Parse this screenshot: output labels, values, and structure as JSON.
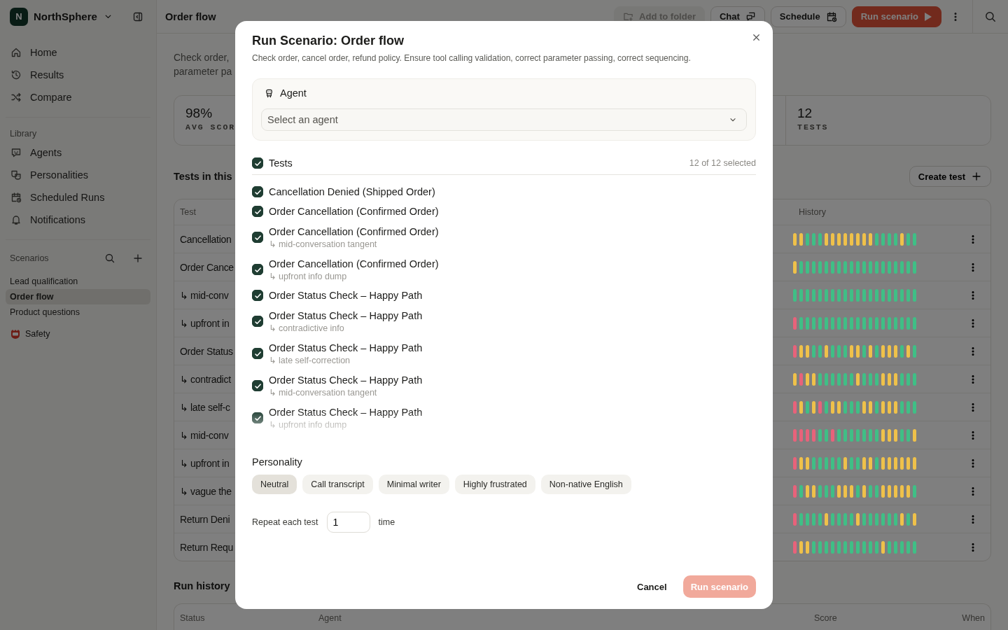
{
  "sidebar": {
    "workspace": {
      "initial": "N",
      "name": "NorthSphere"
    },
    "nav": [
      {
        "label": "Home",
        "kind": "home"
      },
      {
        "label": "Results",
        "kind": "history"
      },
      {
        "label": "Compare",
        "kind": "shuffle"
      }
    ],
    "library_label": "Library",
    "library": [
      {
        "label": "Agents",
        "kind": "agent"
      },
      {
        "label": "Personalities",
        "kind": "masks"
      },
      {
        "label": "Scheduled Runs",
        "kind": "calendar"
      },
      {
        "label": "Notifications",
        "kind": "bell"
      }
    ],
    "scenarios_label": "Scenarios",
    "scenarios": [
      {
        "label": "Lead qualification",
        "selected": false
      },
      {
        "label": "Order flow",
        "selected": true
      },
      {
        "label": "Product questions",
        "selected": false
      }
    ],
    "folders": [
      {
        "label": "Safety"
      }
    ]
  },
  "topbar": {
    "title": "Order flow",
    "actions": [
      {
        "label": "Add to folder",
        "kind": "folder",
        "disabled": true
      },
      {
        "label": "Chat",
        "kind": "chat",
        "disabled": false
      },
      {
        "label": "Schedule",
        "kind": "calendar",
        "disabled": false
      },
      {
        "label": "Run scenario",
        "kind": "run",
        "disabled": false
      }
    ]
  },
  "page": {
    "description": [
      "Check order,",
      "parameter pa"
    ],
    "stats": [
      {
        "value": "98%",
        "label": "AVG SCOR"
      },
      {
        "value": "12",
        "label": "TESTS"
      }
    ],
    "tests_heading": "Tests in this",
    "create_button": "Create test",
    "table": {
      "columns": [
        "Test",
        "History"
      ],
      "rows": [
        {
          "test": "Cancellation",
          "history": [
            {
              "color": "#efc14a"
            },
            {
              "color": "#efc14a"
            },
            {
              "color": "#3fbf86"
            },
            {
              "color": "#3fbf86"
            },
            {
              "color": "#3fbf86"
            },
            {
              "color": "#efc14a"
            },
            {
              "color": "#efc14a"
            },
            {
              "color": "#efc14a"
            },
            {
              "color": "#efc14a"
            },
            {
              "color": "#efc14a"
            },
            {
              "color": "#efc14a"
            },
            {
              "color": "#efc14a"
            },
            {
              "color": "#efc14a"
            },
            {
              "color": "#3fbf86"
            },
            {
              "color": "#3fbf86"
            },
            {
              "color": "#3fbf86"
            },
            {
              "color": "#3fbf86"
            },
            {
              "color": "#efc14a"
            },
            {
              "color": "#3fbf86"
            },
            {
              "color": "#3fbf86"
            }
          ]
        },
        {
          "test": "Order Cance",
          "history": [
            {
              "color": "#efc14a"
            },
            {
              "color": "#3fbf86"
            },
            {
              "color": "#3fbf86"
            },
            {
              "color": "#3fbf86"
            },
            {
              "color": "#3fbf86"
            },
            {
              "color": "#3fbf86"
            },
            {
              "color": "#3fbf86"
            },
            {
              "color": "#3fbf86"
            },
            {
              "color": "#3fbf86"
            },
            {
              "color": "#3fbf86"
            },
            {
              "color": "#3fbf86"
            },
            {
              "color": "#3fbf86"
            },
            {
              "color": "#3fbf86"
            },
            {
              "color": "#3fbf86"
            },
            {
              "color": "#3fbf86"
            },
            {
              "color": "#3fbf86"
            },
            {
              "color": "#3fbf86"
            },
            {
              "color": "#3fbf86"
            },
            {
              "color": "#3fbf86"
            },
            {
              "color": "#3fbf86"
            }
          ]
        },
        {
          "test": "↳ mid-conv",
          "history": [
            {
              "color": "#3fbf86"
            },
            {
              "color": "#3fbf86"
            },
            {
              "color": "#3fbf86"
            },
            {
              "color": "#3fbf86"
            },
            {
              "color": "#3fbf86"
            },
            {
              "color": "#3fbf86"
            },
            {
              "color": "#3fbf86"
            },
            {
              "color": "#3fbf86"
            },
            {
              "color": "#3fbf86"
            },
            {
              "color": "#3fbf86"
            },
            {
              "color": "#3fbf86"
            },
            {
              "color": "#3fbf86"
            },
            {
              "color": "#3fbf86"
            },
            {
              "color": "#3fbf86"
            },
            {
              "color": "#3fbf86"
            },
            {
              "color": "#3fbf86"
            },
            {
              "color": "#3fbf86"
            },
            {
              "color": "#3fbf86"
            },
            {
              "color": "#3fbf86"
            },
            {
              "color": "#3fbf86"
            }
          ]
        },
        {
          "test": "↳ upfront in",
          "history": [
            {
              "color": "#e8627a"
            },
            {
              "color": "#3fbf86"
            },
            {
              "color": "#3fbf86"
            },
            {
              "color": "#3fbf86"
            },
            {
              "color": "#3fbf86"
            },
            {
              "color": "#3fbf86"
            },
            {
              "color": "#3fbf86"
            },
            {
              "color": "#3fbf86"
            },
            {
              "color": "#3fbf86"
            },
            {
              "color": "#3fbf86"
            },
            {
              "color": "#3fbf86"
            },
            {
              "color": "#3fbf86"
            },
            {
              "color": "#3fbf86"
            },
            {
              "color": "#3fbf86"
            },
            {
              "color": "#3fbf86"
            },
            {
              "color": "#3fbf86"
            },
            {
              "color": "#3fbf86"
            },
            {
              "color": "#3fbf86"
            },
            {
              "color": "#3fbf86"
            },
            {
              "color": "#3fbf86"
            }
          ]
        },
        {
          "test": "Order Status",
          "history": [
            {
              "color": "#e8627a"
            },
            {
              "color": "#efc14a"
            },
            {
              "color": "#efc14a"
            },
            {
              "color": "#3fbf86"
            },
            {
              "color": "#3fbf86"
            },
            {
              "color": "#efc14a"
            },
            {
              "color": "#3fbf86"
            },
            {
              "color": "#3fbf86"
            },
            {
              "color": "#3fbf86"
            },
            {
              "color": "#efc14a"
            },
            {
              "color": "#efc14a"
            },
            {
              "color": "#3fbf86"
            },
            {
              "color": "#efc14a"
            },
            {
              "color": "#3fbf86"
            },
            {
              "color": "#efc14a"
            },
            {
              "color": "#efc14a"
            },
            {
              "color": "#efc14a"
            },
            {
              "color": "#3fbf86"
            },
            {
              "color": "#efc14a"
            },
            {
              "color": "#3fbf86"
            }
          ]
        },
        {
          "test": "↳ contradict",
          "history": [
            {
              "color": "#efc14a"
            },
            {
              "color": "#e8627a"
            },
            {
              "color": "#efc14a"
            },
            {
              "color": "#efc14a"
            },
            {
              "color": "#3fbf86"
            },
            {
              "color": "#3fbf86"
            },
            {
              "color": "#3fbf86"
            },
            {
              "color": "#3fbf86"
            },
            {
              "color": "#3fbf86"
            },
            {
              "color": "#3fbf86"
            },
            {
              "color": "#efc14a"
            },
            {
              "color": "#3fbf86"
            },
            {
              "color": "#3fbf86"
            },
            {
              "color": "#3fbf86"
            },
            {
              "color": "#efc14a"
            },
            {
              "color": "#efc14a"
            },
            {
              "color": "#efc14a"
            },
            {
              "color": "#3fbf86"
            },
            {
              "color": "#3fbf86"
            },
            {
              "color": "#3fbf86"
            }
          ]
        },
        {
          "test": "↳ late self-c",
          "history": [
            {
              "color": "#e8627a"
            },
            {
              "color": "#efc14a"
            },
            {
              "color": "#3fbf86"
            },
            {
              "color": "#efc14a"
            },
            {
              "color": "#e8627a"
            },
            {
              "color": "#3fbf86"
            },
            {
              "color": "#efc14a"
            },
            {
              "color": "#efc14a"
            },
            {
              "color": "#3fbf86"
            },
            {
              "color": "#3fbf86"
            },
            {
              "color": "#3fbf86"
            },
            {
              "color": "#efc14a"
            },
            {
              "color": "#efc14a"
            },
            {
              "color": "#3fbf86"
            },
            {
              "color": "#efc14a"
            },
            {
              "color": "#efc14a"
            },
            {
              "color": "#efc14a"
            },
            {
              "color": "#3fbf86"
            },
            {
              "color": "#3fbf86"
            },
            {
              "color": "#3fbf86"
            }
          ]
        },
        {
          "test": "↳ mid-conv",
          "history": [
            {
              "color": "#e8627a"
            },
            {
              "color": "#e8627a"
            },
            {
              "color": "#e8627a"
            },
            {
              "color": "#e8627a"
            },
            {
              "color": "#3fbf86"
            },
            {
              "color": "#3fbf86"
            },
            {
              "color": "#e8627a"
            },
            {
              "color": "#3fbf86"
            },
            {
              "color": "#3fbf86"
            },
            {
              "color": "#3fbf86"
            },
            {
              "color": "#3fbf86"
            },
            {
              "color": "#3fbf86"
            },
            {
              "color": "#3fbf86"
            },
            {
              "color": "#3fbf86"
            },
            {
              "color": "#efc14a"
            },
            {
              "color": "#efc14a"
            },
            {
              "color": "#efc14a"
            },
            {
              "color": "#3fbf86"
            },
            {
              "color": "#3fbf86"
            },
            {
              "color": "#efc14a"
            }
          ]
        },
        {
          "test": "↳ upfront in",
          "history": [
            {
              "color": "#e8627a"
            },
            {
              "color": "#efc14a"
            },
            {
              "color": "#efc14a"
            },
            {
              "color": "#3fbf86"
            },
            {
              "color": "#3fbf86"
            },
            {
              "color": "#3fbf86"
            },
            {
              "color": "#3fbf86"
            },
            {
              "color": "#3fbf86"
            },
            {
              "color": "#efc14a"
            },
            {
              "color": "#3fbf86"
            },
            {
              "color": "#3fbf86"
            },
            {
              "color": "#efc14a"
            },
            {
              "color": "#efc14a"
            },
            {
              "color": "#3fbf86"
            },
            {
              "color": "#efc14a"
            },
            {
              "color": "#efc14a"
            },
            {
              "color": "#efc14a"
            },
            {
              "color": "#efc14a"
            },
            {
              "color": "#efc14a"
            },
            {
              "color": "#efc14a"
            }
          ]
        },
        {
          "test": "↳ vague the",
          "history": [
            {
              "color": "#e8627a"
            },
            {
              "color": "#3fbf86"
            },
            {
              "color": "#efc14a"
            },
            {
              "color": "#efc14a"
            },
            {
              "color": "#3fbf86"
            },
            {
              "color": "#3fbf86"
            },
            {
              "color": "#3fbf86"
            },
            {
              "color": "#efc14a"
            },
            {
              "color": "#efc14a"
            },
            {
              "color": "#efc14a"
            },
            {
              "color": "#3fbf86"
            },
            {
              "color": "#efc14a"
            },
            {
              "color": "#3fbf86"
            },
            {
              "color": "#3fbf86"
            },
            {
              "color": "#efc14a"
            },
            {
              "color": "#efc14a"
            },
            {
              "color": "#efc14a"
            },
            {
              "color": "#efc14a"
            },
            {
              "color": "#efc14a"
            },
            {
              "color": "#3fbf86"
            }
          ]
        },
        {
          "test": "Return Deni",
          "history": [
            {
              "color": "#e8627a"
            },
            {
              "color": "#3fbf86"
            },
            {
              "color": "#3fbf86"
            },
            {
              "color": "#3fbf86"
            },
            {
              "color": "#3fbf86"
            },
            {
              "color": "#efc14a"
            },
            {
              "color": "#3fbf86"
            },
            {
              "color": "#3fbf86"
            },
            {
              "color": "#3fbf86"
            },
            {
              "color": "#3fbf86"
            },
            {
              "color": "#efc14a"
            },
            {
              "color": "#3fbf86"
            },
            {
              "color": "#3fbf86"
            },
            {
              "color": "#3fbf86"
            },
            {
              "color": "#3fbf86"
            },
            {
              "color": "#3fbf86"
            },
            {
              "color": "#3fbf86"
            },
            {
              "color": "#efc14a"
            },
            {
              "color": "#3fbf86"
            },
            {
              "color": "#efc14a"
            }
          ]
        },
        {
          "test": "Return Requ",
          "history": [
            {
              "color": "#e8627a"
            },
            {
              "color": "#efc14a"
            },
            {
              "color": "#efc14a"
            },
            {
              "color": "#3fbf86"
            },
            {
              "color": "#3fbf86"
            },
            {
              "color": "#3fbf86"
            },
            {
              "color": "#3fbf86"
            },
            {
              "color": "#3fbf86"
            },
            {
              "color": "#3fbf86"
            },
            {
              "color": "#3fbf86"
            },
            {
              "color": "#3fbf86"
            },
            {
              "color": "#3fbf86"
            },
            {
              "color": "#3fbf86"
            },
            {
              "color": "#3fbf86"
            },
            {
              "color": "#efc14a"
            },
            {
              "color": "#3fbf86"
            },
            {
              "color": "#3fbf86"
            },
            {
              "color": "#3fbf86"
            },
            {
              "color": "#3fbf86"
            },
            {
              "color": "#3fbf86"
            }
          ]
        }
      ]
    },
    "run_history": {
      "heading": "Run history",
      "columns": [
        "Status",
        "Agent",
        "Score",
        "When"
      ]
    }
  },
  "modal": {
    "title": "Run Scenario: Order flow",
    "description": "Check order, cancel order, refund policy. Ensure tool calling validation, correct parameter passing, correct sequencing.",
    "agent": {
      "label": "Agent",
      "placeholder": "Select an agent"
    },
    "tests": {
      "label": "Tests",
      "checked": true,
      "count": "12 of 12 selected",
      "items": [
        {
          "title": "Cancellation Denied (Shipped Order)",
          "checked": true
        },
        {
          "title": "Order Cancellation (Confirmed Order)",
          "checked": true
        },
        {
          "title": "Order Cancellation (Confirmed Order)",
          "variant": "↳ mid-conversation tangent",
          "checked": true
        },
        {
          "title": "Order Cancellation (Confirmed Order)",
          "variant": "↳ upfront info dump",
          "checked": true
        },
        {
          "title": "Order Status Check – Happy Path",
          "checked": true
        },
        {
          "title": "Order Status Check – Happy Path",
          "variant": "↳ contradictive info",
          "checked": true
        },
        {
          "title": "Order Status Check – Happy Path",
          "variant": "↳ late self-correction",
          "checked": true
        },
        {
          "title": "Order Status Check – Happy Path",
          "variant": "↳ mid-conversation tangent",
          "checked": true
        },
        {
          "title": "Order Status Check – Happy Path",
          "variant": "↳ upfront info dump",
          "checked": true
        }
      ]
    },
    "personality": {
      "label": "Personality",
      "options": [
        {
          "label": "Neutral",
          "selected": true
        },
        {
          "label": "Call transcript",
          "selected": false
        },
        {
          "label": "Minimal writer",
          "selected": false
        },
        {
          "label": "Highly frustrated",
          "selected": false
        },
        {
          "label": "Non-native English",
          "selected": false
        }
      ]
    },
    "repeat": {
      "label": "Repeat each test",
      "value": "1",
      "unit": "time"
    },
    "buttons": [
      {
        "label": "Cancel",
        "kind": "secondary",
        "disabled": false
      },
      {
        "label": "Run scenario",
        "kind": "primary",
        "disabled": true
      }
    ]
  }
}
